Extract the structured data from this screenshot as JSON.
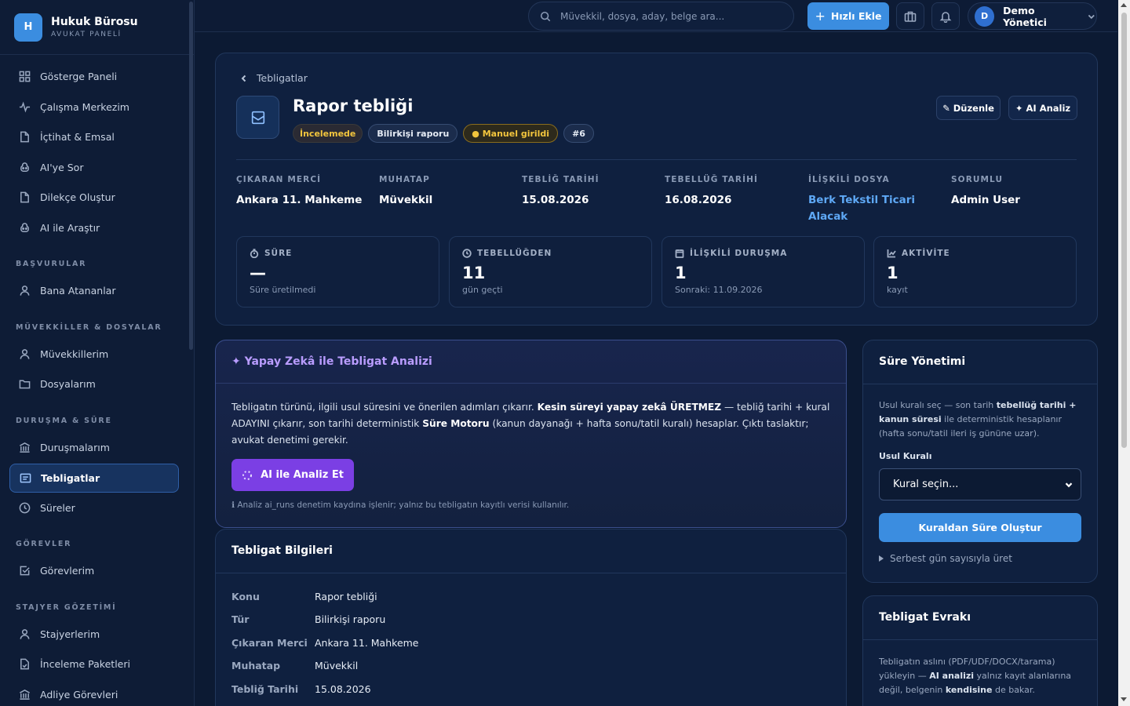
{
  "brand": {
    "logo_letter": "H",
    "title": "Hukuk Bürosu",
    "subtitle": "AVUKAT PANELİ"
  },
  "sidebar": {
    "items": [
      {
        "label": "Gösterge Paneli",
        "icon": "grid-icon"
      },
      {
        "label": "Çalışma Merkezim",
        "icon": "activity-icon"
      },
      {
        "label": "İçtihat & Emsal",
        "icon": "file-icon"
      },
      {
        "label": "AI'ye Sor",
        "icon": "ai-icon"
      },
      {
        "label": "Dilekçe Oluştur",
        "icon": "file-icon"
      },
      {
        "label": "AI ile Araştır",
        "icon": "ai-icon"
      },
      {
        "label": "Bana Atananlar",
        "icon": "user-icon"
      },
      {
        "label": "Müvekkillerim",
        "icon": "user-icon"
      },
      {
        "label": "Dosyalarım",
        "icon": "folder-icon"
      },
      {
        "label": "Duruşmalarım",
        "icon": "courthouse-icon"
      },
      {
        "label": "Tebligatlar",
        "icon": "inbox-icon",
        "active": true
      },
      {
        "label": "Süreler",
        "icon": "clock-icon"
      },
      {
        "label": "Görevlerim",
        "icon": "checkbox-icon"
      },
      {
        "label": "Stajyerlerim",
        "icon": "user-icon"
      },
      {
        "label": "İnceleme Paketleri",
        "icon": "file-check-icon"
      },
      {
        "label": "Adliye Görevleri",
        "icon": "courthouse-icon"
      }
    ],
    "sections": {
      "basvurular": "BAŞVURULAR",
      "muvekkiller": "MÜVEKKİLLER & DOSYALAR",
      "durusma": "DURUŞMA & SÜRE",
      "gorevler": "GÖREVLER",
      "stajyer": "STAJYER GÖZETİMİ"
    }
  },
  "topbar": {
    "search_placeholder": "Müvekkil, dosya, aday, belge ara...",
    "quick_add": "Hızlı Ekle",
    "user_initial": "D",
    "user_name": "Demo Yönetici"
  },
  "header": {
    "breadcrumb": "Tebligatlar",
    "title": "Rapor tebliği",
    "badges": {
      "status": "İncelemede",
      "type": "Bilirkişi raporu",
      "source": "● Manuel girildi",
      "id": "#6"
    },
    "edit_label": "✎ Düzenle",
    "ai_label": "✦ AI Analiz",
    "meta": [
      {
        "key": "ÇIKARAN MERCİ",
        "value": "Ankara 11. Mahkeme"
      },
      {
        "key": "MUHATAP",
        "value": "Müvekkil"
      },
      {
        "key": "TEBLİĞ TARİHİ",
        "value": "15.08.2026"
      },
      {
        "key": "TEBELLÜĞ TARİHİ",
        "value": "16.08.2026"
      },
      {
        "key": "İLİŞKİLİ DOSYA",
        "value": "Berk Tekstil Ticari Alacak"
      },
      {
        "key": "SORUMLU",
        "value": "Admin User"
      }
    ],
    "stats": [
      {
        "key": "SÜRE",
        "value": "—",
        "sub": "Süre üretilmedi",
        "icon": "timer-icon"
      },
      {
        "key": "TEBELLÜĞDEN",
        "value": "11",
        "sub": "gün geçti",
        "icon": "clock-icon"
      },
      {
        "key": "İLİŞKİLİ DURUŞMA",
        "value": "1",
        "sub": "Sonraki: 11.09.2026",
        "icon": "calendar-icon"
      },
      {
        "key": "AKTİVİTE",
        "value": "1",
        "sub": "kayıt",
        "icon": "chart-icon"
      }
    ]
  },
  "ai_panel": {
    "title": "✦ Yapay Zekâ ile Tebligat Analizi",
    "text_1": "Tebligatın türünü, ilgili usul süresini ve önerilen adımları çıkarır. ",
    "text_bold_1": "Kesin süreyi yapay zekâ ÜRETMEZ",
    "text_2": " — tebliğ tarihi + kural ADAYINI çıkarır, son tarihi deterministik ",
    "text_bold_2": "Süre Motoru",
    "text_3": " (kanun dayanağı + hafta sonu/tatil kuralı) hesaplar. Çıktı taslaktır; avukat denetimi gerekir.",
    "button": "AI ile Analiz Et",
    "note": "ℹ  Analiz ai_runs denetim kaydına işlenir; yalnız bu tebligatın kayıtlı verisi kullanılır."
  },
  "info": {
    "title": "Tebligat Bilgileri",
    "rows": [
      {
        "key": "Konu",
        "value": "Rapor tebliği"
      },
      {
        "key": "Tür",
        "value": "Bilirkişi raporu"
      },
      {
        "key": "Çıkaran Merci",
        "value": "Ankara 11. Mahkeme"
      },
      {
        "key": "Muhatap",
        "value": "Müvekkil"
      },
      {
        "key": "Tebliğ Tarihi",
        "value": "15.08.2026"
      }
    ]
  },
  "sure": {
    "title": "Süre Yönetimi",
    "desc_1": "Usul kuralı seç — son tarih ",
    "desc_bold_1": "tebellüğ tarihi + kanun süresi",
    "desc_2": " ile deterministik hesaplanır (hafta sonu/tatil ileri iş gününe uzar).",
    "field_label": "Usul Kuralı",
    "select_value": "Kural seçin...",
    "button": "Kuraldan Süre Oluştur",
    "details": "Serbest gün sayısıyla üret"
  },
  "evrak": {
    "title": "Tebligat Evrakı",
    "desc_1": "Tebligatın aslını (PDF/UDF/DOCX/tarama) yükleyin — ",
    "desc_bold_1": "AI analizi",
    "desc_2": " yalnız kayıt alanlarına değil, belgenin ",
    "desc_bold_2": "kendisine",
    "desc_3": " de bakar."
  }
}
